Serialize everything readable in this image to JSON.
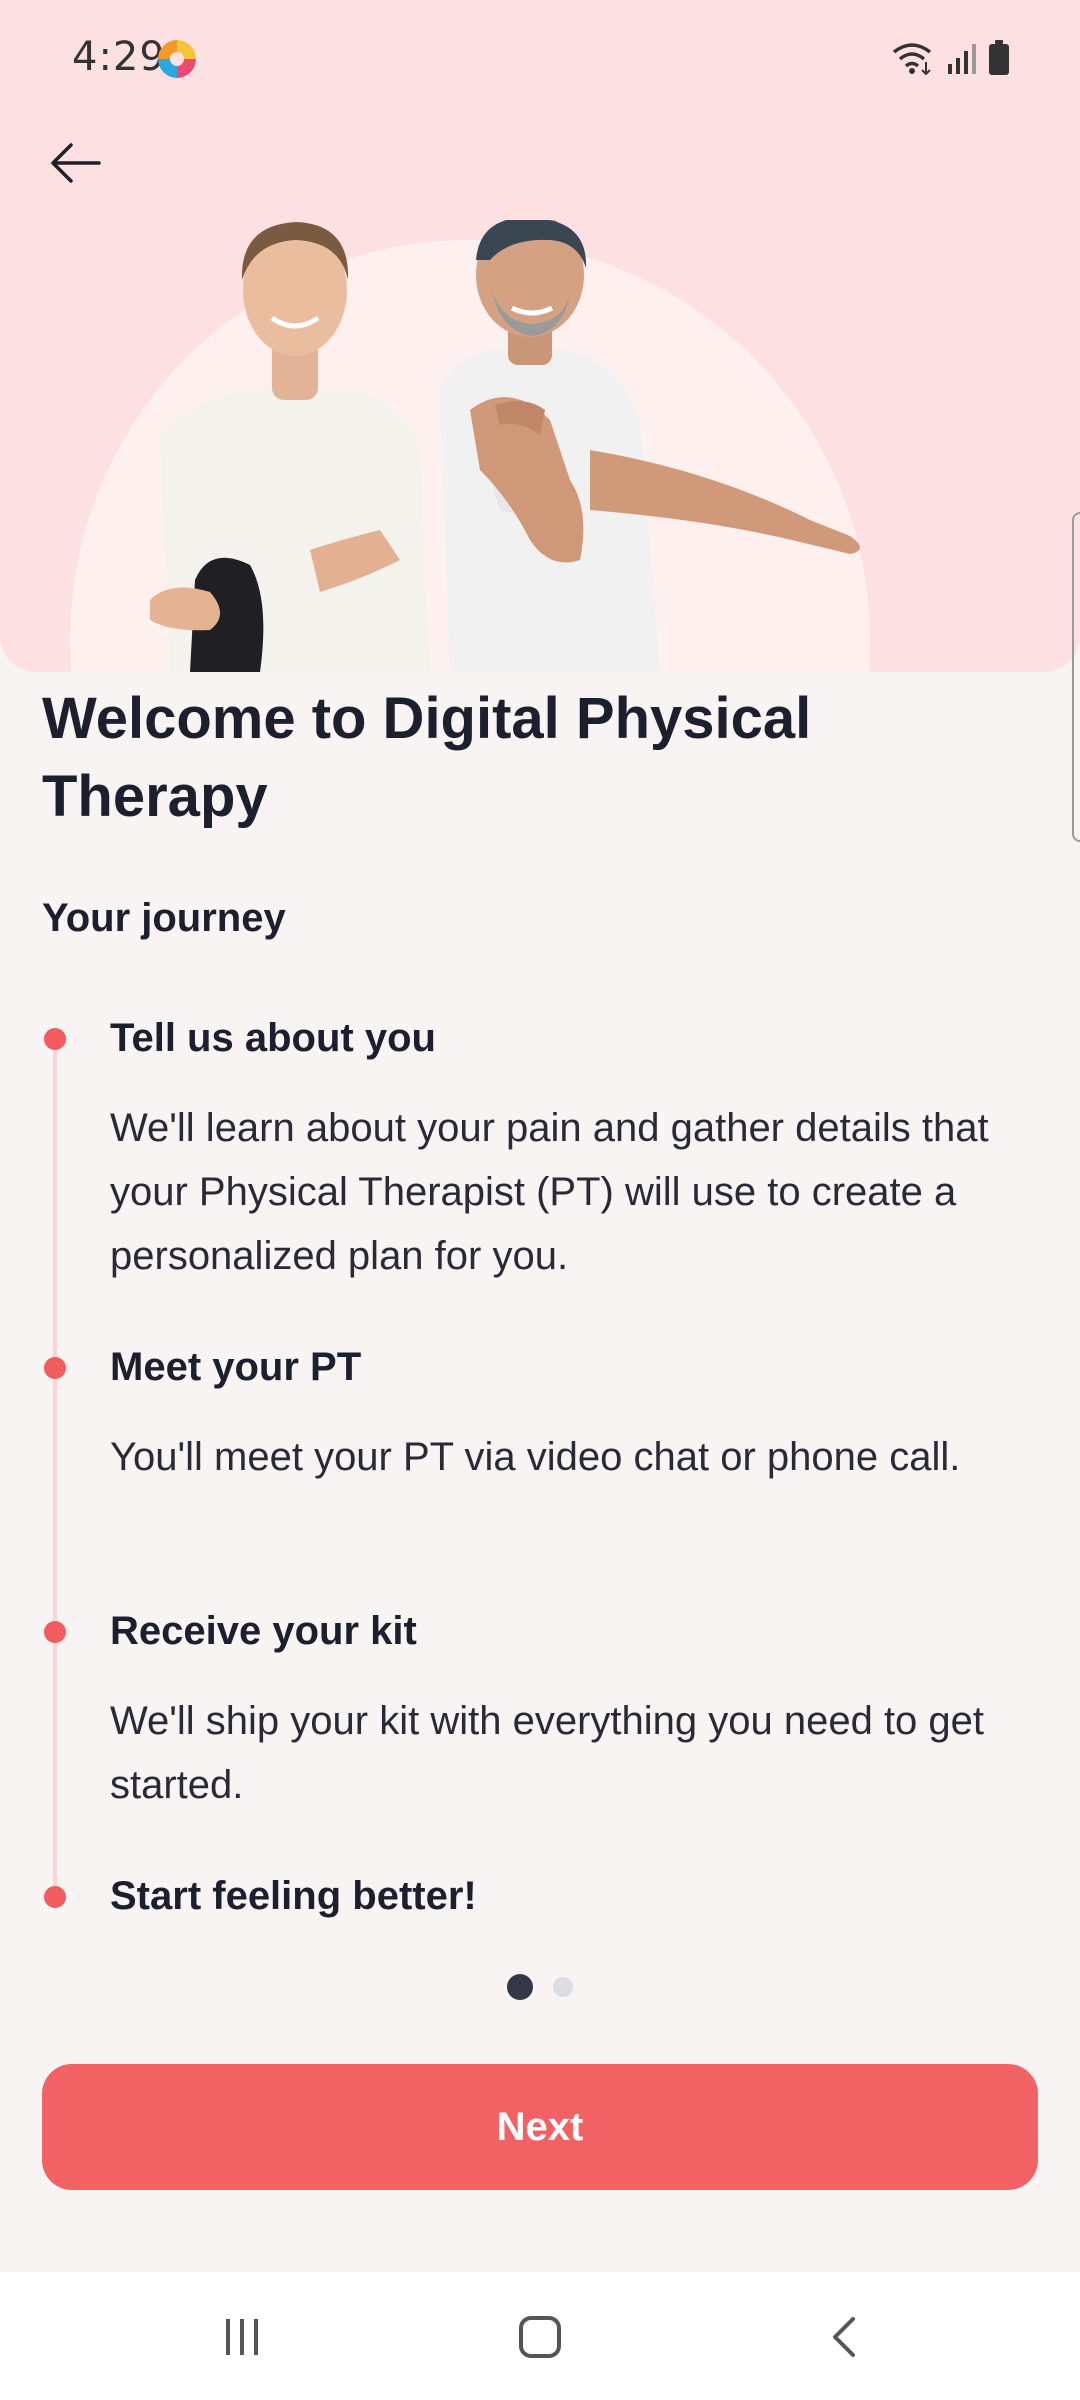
{
  "status_bar": {
    "time": "4:29"
  },
  "header": {
    "back_icon": "arrow-left-icon"
  },
  "content": {
    "title": "Welcome to Digital Physical Therapy",
    "subtitle": "Your journey",
    "steps": [
      {
        "title": "Tell us about you",
        "description": "We'll learn about your pain and gather details that your Physical Therapist (PT) will use to create a personalized plan for you."
      },
      {
        "title": "Meet your PT",
        "description": "You'll meet your PT via video chat or phone call."
      },
      {
        "title": "Receive your kit",
        "description": "We'll ship your kit with everything you need to get started."
      },
      {
        "title": "Start feeling better!",
        "description": ""
      }
    ]
  },
  "pager": {
    "total": 2,
    "current": 1
  },
  "actions": {
    "next_label": "Next"
  },
  "colors": {
    "accent": "#f26163",
    "hero_background": "#fde1e2",
    "page_background": "#f8f4f3",
    "title_text": "#1e1f2e",
    "timeline": "#fbd3d4"
  }
}
